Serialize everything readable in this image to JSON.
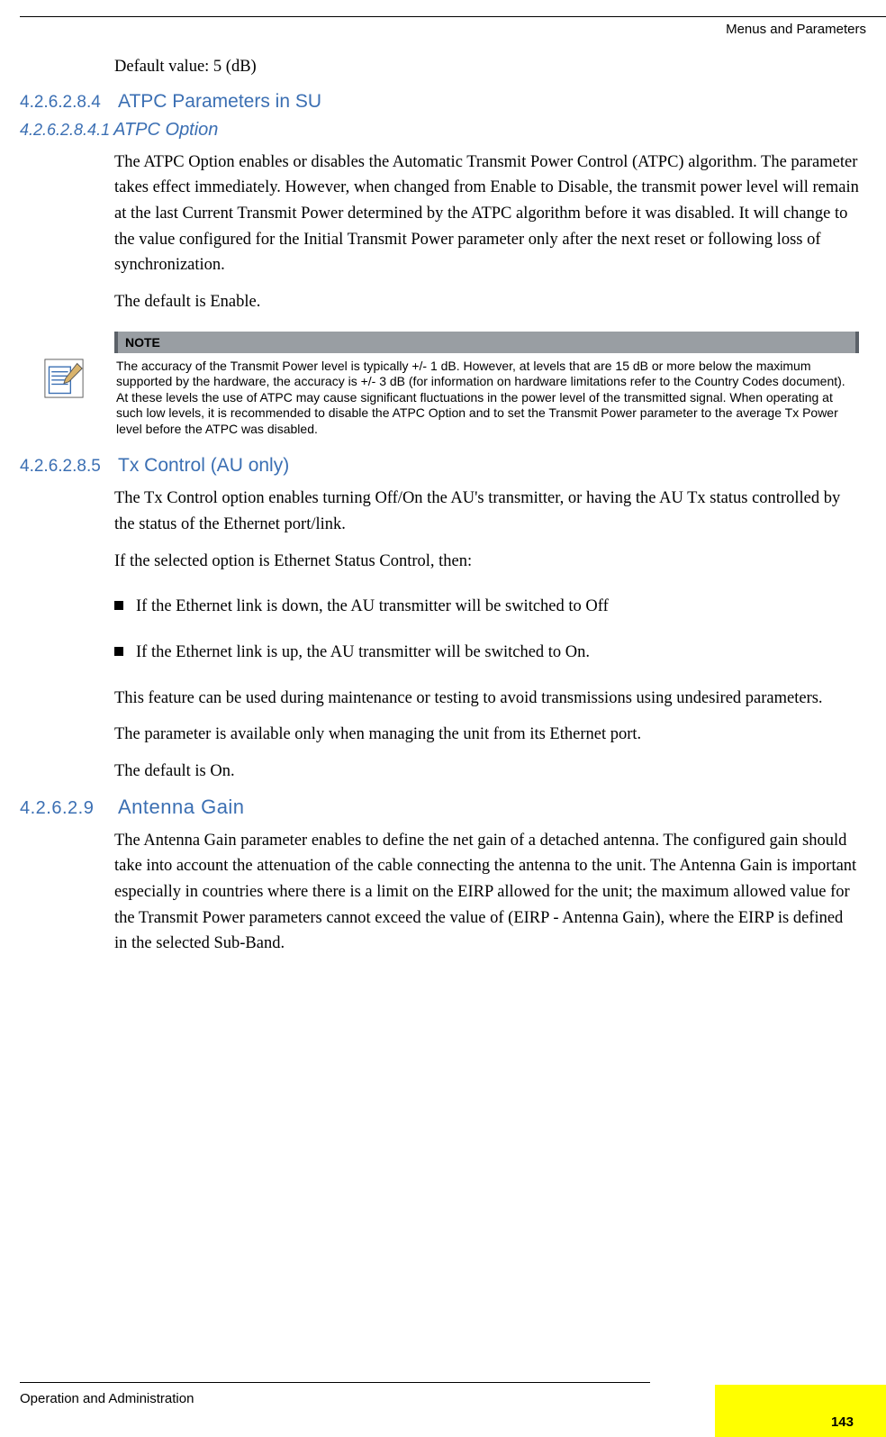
{
  "header": {
    "right": "Menus and Parameters"
  },
  "footer": {
    "left": "Operation and Administration",
    "page": "143"
  },
  "p_default": "Default value: 5 (dB)",
  "s1": {
    "num": "4.2.6.2.8.4",
    "title": "ATPC Parameters in SU"
  },
  "s1a": {
    "num": "4.2.6.2.8.4.1",
    "title": "ATPC Option"
  },
  "p1": "The ATPC Option enables or disables the Automatic Transmit Power Control (ATPC) algorithm. The parameter takes effect immediately. However, when changed from Enable to Disable, the transmit power level will remain at the last Current Transmit Power determined by the ATPC algorithm before it was disabled. It will change to the value configured for the Initial Transmit Power parameter only after the next reset or following loss of synchronization.",
  "p2": "The default is Enable.",
  "note": {
    "label": "NOTE",
    "text": "The accuracy of the Transmit Power level is typically +/- 1 dB. However, at levels that are 15 dB or more below the maximum supported by the hardware, the accuracy is +/- 3 dB (for information on hardware limitations refer to the Country Codes document). At these levels the use of ATPC may cause significant fluctuations in the power level of the transmitted signal. When operating at such low levels, it is recommended to disable the ATPC Option and to set the Transmit Power parameter to the average Tx Power level before the ATPC was disabled."
  },
  "s2": {
    "num": "4.2.6.2.8.5",
    "title": "Tx Control (AU only)"
  },
  "p3": "The Tx Control option enables turning Off/On the AU's transmitter, or having the AU Tx status controlled by the status of the Ethernet port/link.",
  "p4": "If the selected option is Ethernet Status Control, then:",
  "b1": "If the Ethernet link is down, the AU transmitter will be switched to Off",
  "b2": "If the Ethernet link is up, the AU transmitter will be switched to On.",
  "p5": "This feature can be used during maintenance or testing to avoid transmissions using undesired parameters.",
  "p6": "The parameter is available only when managing the unit from its Ethernet port.",
  "p7": "The default is On.",
  "s3": {
    "num": "4.2.6.2.9",
    "title": "Antenna Gain"
  },
  "p8": "The Antenna Gain parameter enables to define the net gain of a detached antenna. The configured gain should take into account the attenuation of the cable connecting the antenna to the unit. The Antenna Gain is important especially in countries where there is a limit on the EIRP allowed for the unit; the maximum allowed value for the Transmit Power parameters cannot exceed the value of (EIRP - Antenna Gain), where the EIRP is defined in the selected Sub-Band."
}
